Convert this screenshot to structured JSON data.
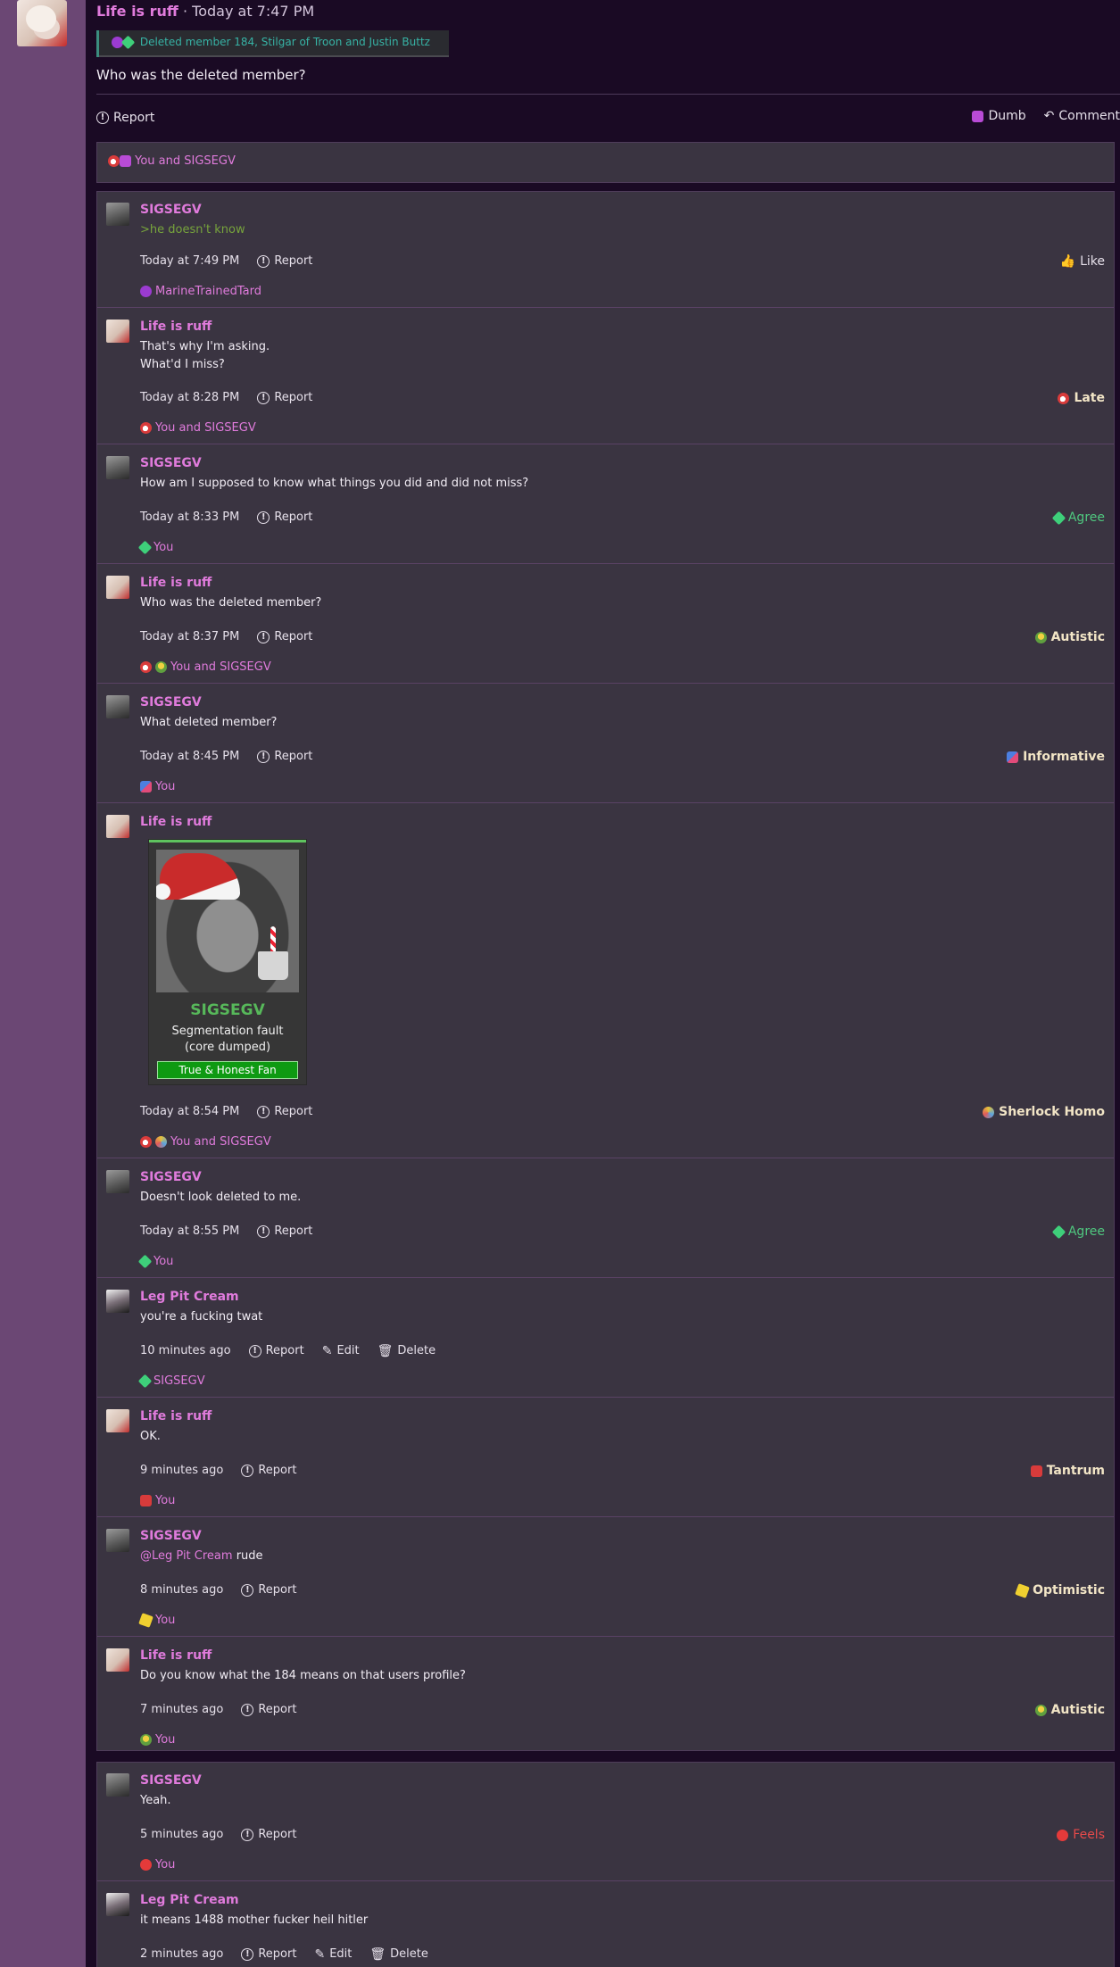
{
  "post": {
    "author": "Life is ruff",
    "timestamp": " · Today at 7:47 PM",
    "quote": "Deleted member 184, Stilgar of Troon and Justin Buttz",
    "body": "Who was the deleted member?",
    "report": "Report",
    "dumb": "Dumb",
    "comment": "Comment",
    "reactions": "You and SIGSEGV"
  },
  "comments": [
    {
      "author": "SIGSEGV",
      "lines": [
        ">he doesn't know"
      ],
      "time": "Today at 7:49 PM",
      "reaction": "Like",
      "reacted_by": "MarineTrainedTard"
    },
    {
      "author": "Life is ruff",
      "lines": [
        "That's why I'm asking.",
        "What'd I miss?"
      ],
      "time": "Today at 8:28 PM",
      "reaction": "Late",
      "reacted_by": "You and SIGSEGV"
    },
    {
      "author": "SIGSEGV",
      "lines": [
        "How am I supposed to know what things you did and did not miss?"
      ],
      "time": "Today at 8:33 PM",
      "reaction": "Agree",
      "reacted_by": "You"
    },
    {
      "author": "Life is ruff",
      "lines": [
        "Who was the deleted member?"
      ],
      "time": "Today at 8:37 PM",
      "reaction": "Autistic",
      "reacted_by": "You and SIGSEGV"
    },
    {
      "author": "SIGSEGV",
      "lines": [
        "What deleted member?"
      ],
      "time": "Today at 8:45 PM",
      "reaction": "Informative",
      "reacted_by": "You"
    },
    {
      "author": "Life is ruff",
      "embed": {
        "title": "SIGSEGV",
        "sub1": "Segmentation fault",
        "sub2": "(core dumped)",
        "badge": "True & Honest Fan"
      },
      "time": "Today at 8:54 PM",
      "reaction": "Sherlock Homo",
      "reacted_by": "You and SIGSEGV"
    },
    {
      "author": "SIGSEGV",
      "lines": [
        "Doesn't look deleted to me."
      ],
      "time": "Today at 8:55 PM",
      "reaction": "Agree",
      "reacted_by": "You"
    },
    {
      "author": "Leg Pit Cream",
      "lines": [
        "you're a fucking twat"
      ],
      "time": "10 minutes ago",
      "edit": "Edit",
      "delete": "Delete",
      "reacted_by": "SIGSEGV"
    },
    {
      "author": "Life is ruff",
      "lines": [
        "OK."
      ],
      "time": "9 minutes ago",
      "reaction": "Tantrum",
      "reacted_by": "You"
    },
    {
      "author": "SIGSEGV",
      "mention": "@Leg Pit Cream",
      "mention_rest": " rude",
      "time": "8 minutes ago",
      "reaction": "Optimistic",
      "reacted_by": "You"
    },
    {
      "author": "Life is ruff",
      "lines": [
        "Do you know what the 184 means on that users profile?"
      ],
      "time": "7 minutes ago",
      "reaction": "Autistic",
      "reacted_by": "You"
    },
    {
      "author": "SIGSEGV",
      "lines": [
        "Yeah."
      ],
      "time": "5 minutes ago",
      "reaction": "Feels",
      "reacted_by": "You"
    },
    {
      "author": "Leg Pit Cream",
      "lines": [
        "it means 1488 mother fucker heil hitler"
      ],
      "time": "2 minutes ago",
      "edit": "Edit",
      "delete": "Delete"
    }
  ],
  "report_label": "Report"
}
